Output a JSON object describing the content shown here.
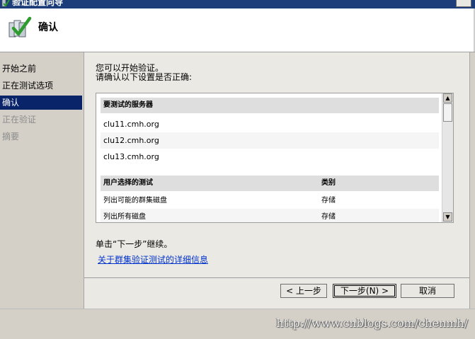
{
  "window": {
    "title": "验证配置向导",
    "header_title": "确认"
  },
  "sidebar": {
    "items": [
      {
        "label": "开始之前",
        "state": "normal"
      },
      {
        "label": "正在测试选项",
        "state": "normal"
      },
      {
        "label": "确认",
        "state": "active"
      },
      {
        "label": "正在验证",
        "state": "disabled"
      },
      {
        "label": "摘要",
        "state": "disabled"
      }
    ]
  },
  "main": {
    "intro_line1": "您可以开始验证。",
    "intro_line2": "请确认以下设置是否正确:",
    "servers_header": "要测试的服务器",
    "servers": [
      "clu11.cmh.org",
      "clu12.cmh.org",
      "clu13.cmh.org"
    ],
    "tests_header": "用户选择的测试",
    "category_header": "类别",
    "tests": [
      {
        "name": "列出可能的群集磁盘",
        "category": "存储"
      },
      {
        "name": "列出所有磁盘",
        "category": "存储"
      }
    ],
    "next_hint": "单击“下一步”继续。",
    "details_link": "关于群集验证测试的详细信息"
  },
  "buttons": {
    "back": "< 上一步",
    "next": "下一步(N) >",
    "cancel": "取消"
  },
  "watermark": "http://www.cnblogs.com/chenmh/",
  "colors": {
    "selection": "#0a246a",
    "link": "#0033cc",
    "title_bar": "#1c3c7a"
  }
}
